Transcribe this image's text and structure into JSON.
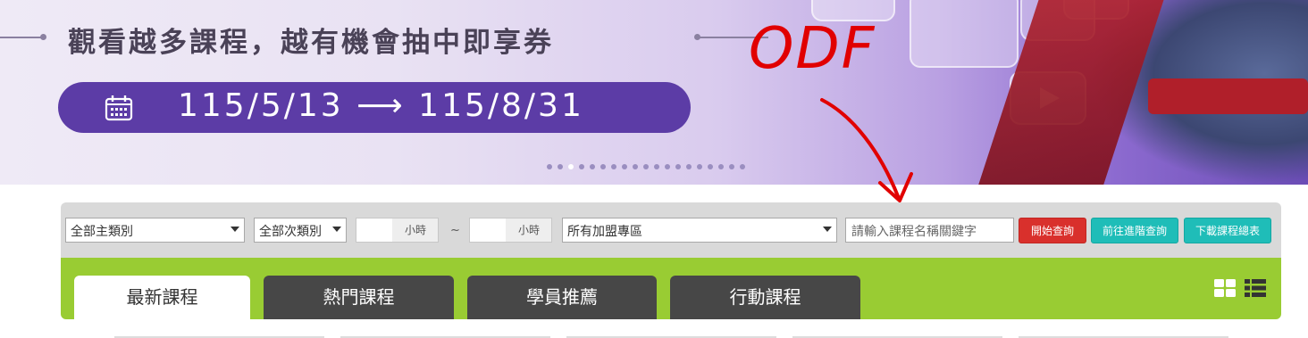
{
  "banner": {
    "title": "觀看越多課程，越有機會抽中即享券",
    "date_range": "115/5/13 ⟶ 115/8/31",
    "calendar_icon": "calendar-icon",
    "carousel_dot_count": 19,
    "carousel_active_index": 2
  },
  "annotation": {
    "text": "ODF",
    "color": "#e10000"
  },
  "search": {
    "main_category": "全部主類別",
    "sub_category": "全部次類別",
    "hours_from_label": "小時",
    "hours_from_value": "",
    "range_separator": "~",
    "hours_to_label": "小時",
    "hours_to_value": "",
    "zone": "所有加盟專區",
    "keyword_placeholder": "請輸入課程名稱關鍵字",
    "search_button": "開始查詢",
    "advanced_button": "前往進階查詢",
    "download_button": "下載課程總表"
  },
  "tabs": [
    {
      "label": "最新課程",
      "active": true
    },
    {
      "label": "熱門課程",
      "active": false
    },
    {
      "label": "學員推薦",
      "active": false
    },
    {
      "label": "行動課程",
      "active": false
    }
  ],
  "view_toggle": {
    "grid": "grid-view-icon",
    "list": "list-view-icon"
  },
  "colors": {
    "tab_bar": "#99cc33",
    "search_button": "#d9302c",
    "teal_button": "#1fbdb8",
    "inactive_tab": "#474747",
    "date_pill": "#5c3ca6"
  }
}
